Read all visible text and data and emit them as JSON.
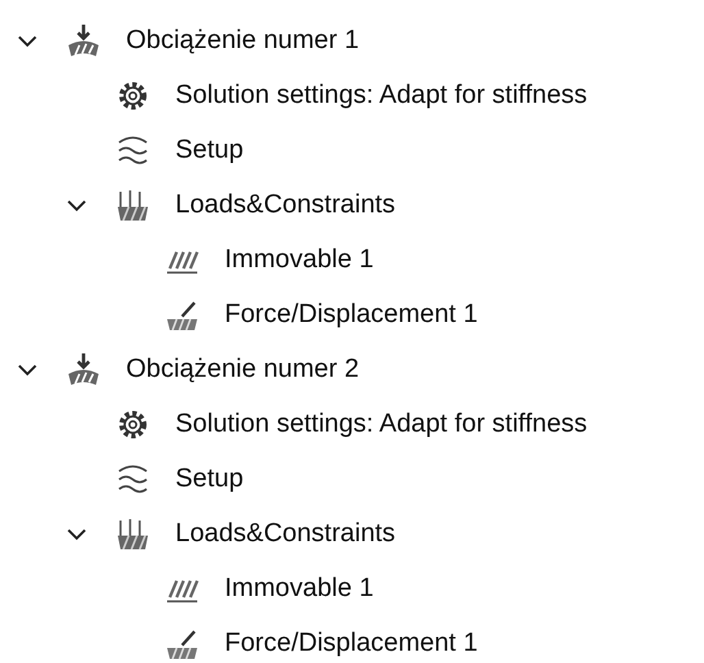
{
  "tree": [
    {
      "kind": "load-case",
      "label": "Obciążenie numer 1",
      "expanded": true,
      "children": [
        {
          "kind": "settings",
          "label": "Solution settings: Adapt for stiffness"
        },
        {
          "kind": "setup",
          "label": "Setup"
        },
        {
          "kind": "loads",
          "label": "Loads&Constraints",
          "expanded": true,
          "children": [
            {
              "kind": "immovable",
              "label": "Immovable 1"
            },
            {
              "kind": "force",
              "label": "Force/Displacement 1"
            }
          ]
        }
      ]
    },
    {
      "kind": "load-case",
      "label": "Obciążenie numer 2",
      "expanded": true,
      "children": [
        {
          "kind": "settings",
          "label": "Solution settings: Adapt for stiffness"
        },
        {
          "kind": "setup",
          "label": "Setup"
        },
        {
          "kind": "loads",
          "label": "Loads&Constraints",
          "expanded": true,
          "children": [
            {
              "kind": "immovable",
              "label": "Immovable 1"
            },
            {
              "kind": "force",
              "label": "Force/Displacement 1"
            }
          ]
        }
      ]
    }
  ]
}
